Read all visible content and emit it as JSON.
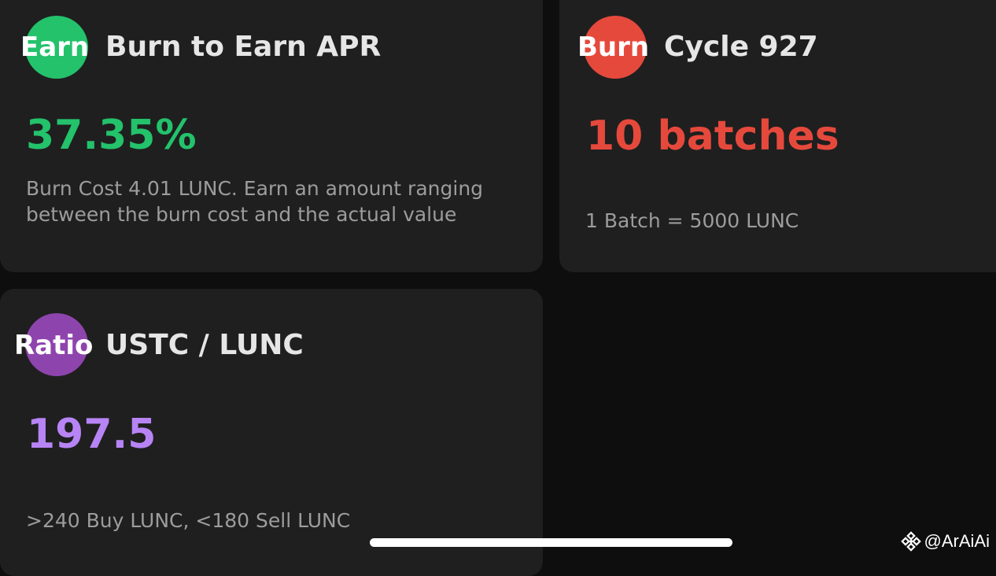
{
  "cards": {
    "apr": {
      "badge": "Earn",
      "badge_color": "#23c26b",
      "title": "Burn to Earn APR",
      "value": "37.35%",
      "description": "Burn Cost 4.01 LUNC. Earn an amount ranging between the burn cost and the actual value"
    },
    "burn": {
      "badge": "Burn",
      "badge_color": "#e5493c",
      "title": "Cycle 927",
      "value": "10 batches",
      "description": "1 Batch = 5000 LUNC"
    },
    "ratio": {
      "badge": "Ratio",
      "badge_color": "#8e44ad",
      "title": "USTC / LUNC",
      "value": "197.5",
      "value_color": "#b784f5",
      "description": ">240 Buy LUNC, <180 Sell LUNC"
    }
  },
  "watermark": {
    "icon": "binance-logo-icon",
    "text": "@ArAiAi"
  }
}
